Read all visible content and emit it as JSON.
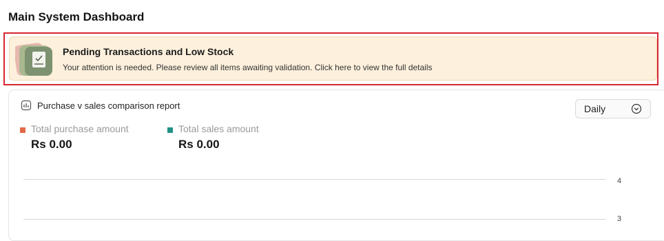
{
  "page": {
    "title": "Main System Dashboard"
  },
  "alert": {
    "title": "Pending Transactions and Low Stock",
    "message": "Your attention is needed. Please review all items awaiting validation. Click here to view the full details"
  },
  "report": {
    "title": "Purchase v sales comparison report",
    "period": "Daily",
    "legend": [
      {
        "label": "Total purchase amount",
        "value": "Rs 0.00",
        "color": "#e26a47"
      },
      {
        "label": "Total sales amount",
        "value": "Rs 0.00",
        "color": "#1f9384"
      }
    ]
  },
  "chart_data": {
    "type": "bar",
    "series": [
      {
        "name": "Total purchase amount",
        "values": []
      },
      {
        "name": "Total sales amount",
        "values": []
      }
    ],
    "y_ticks": [
      "4",
      "3"
    ],
    "grid": true
  }
}
